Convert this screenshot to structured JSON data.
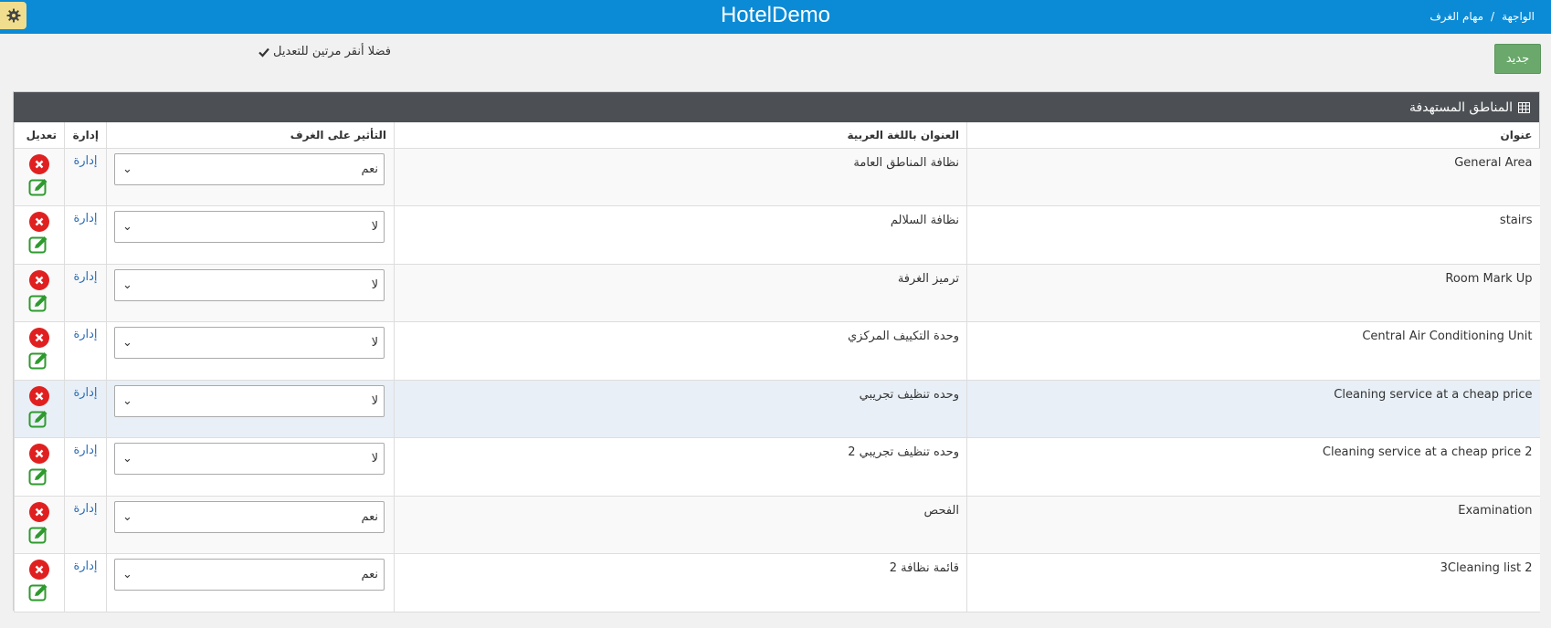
{
  "header": {
    "app_title": "HotelDemo",
    "breadcrumb": [
      "الواجهة",
      "/",
      "مهام الغرف"
    ]
  },
  "toolbar": {
    "new_label": "جديد",
    "hint": "فضلا أنقر مرتين للتعديل"
  },
  "panel": {
    "title": "المناطق المستهدفة",
    "columns": {
      "title": "عنوان",
      "arabic_title": "العنوان باللغة العربية",
      "affect_rooms": "التأثير على الغرف",
      "manage": "إدارة",
      "edit": "تعديل"
    },
    "rows": [
      {
        "title": "General Area",
        "arabic_title": "نظافة المناطق العامة",
        "affect": "نعم",
        "manage": "إدارة"
      },
      {
        "title": "stairs",
        "arabic_title": "نظافة السلالم",
        "affect": "لا",
        "manage": "إدارة"
      },
      {
        "title": "Room Mark Up",
        "arabic_title": "ترميز الغرفة",
        "affect": "لا",
        "manage": "إدارة"
      },
      {
        "title": "Central Air Conditioning Unit",
        "arabic_title": "وحدة التكييف المركزي",
        "affect": "لا",
        "manage": "إدارة"
      },
      {
        "title": "Cleaning service at a cheap price",
        "arabic_title": "وحده تنظيف تجريبي",
        "affect": "لا",
        "manage": "إدارة"
      },
      {
        "title": "Cleaning service at a cheap price 2",
        "arabic_title": "وحده تنظيف تجريبي 2",
        "affect": "لا",
        "manage": "إدارة"
      },
      {
        "title": "Examination",
        "arabic_title": "الفحص",
        "affect": "نعم",
        "manage": "إدارة"
      },
      {
        "title": "3Cleaning list 2",
        "arabic_title": "قائمة نظافة 2",
        "affect": "نعم",
        "manage": "إدارة"
      }
    ]
  },
  "colors": {
    "topbar": "#0b8bd6",
    "new_button": "#6aa96b",
    "panel_header": "#4c5054",
    "delete": "#e02020",
    "edit": "#2e9a2e",
    "link": "#2a6cb5"
  }
}
